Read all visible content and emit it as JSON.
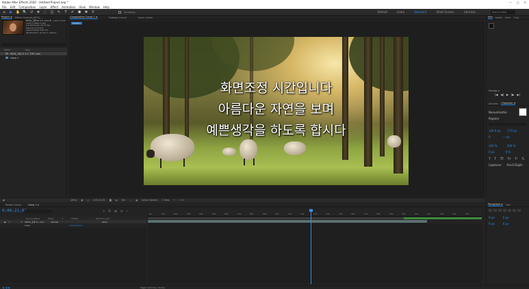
{
  "app": {
    "title": "Adobe After Effects 2020 - Untitled Project.aep *",
    "window_controls": [
      "—",
      "□",
      "✕"
    ]
  },
  "menu": [
    "File",
    "Edit",
    "Composition",
    "Layer",
    "Effect",
    "Animation",
    "View",
    "Window",
    "Help"
  ],
  "toolbar": {
    "tools": [
      "⌂",
      "▶",
      "✋",
      "🔍",
      "↺",
      "✥",
      "⬚",
      "◫",
      "✎",
      "T",
      "✐",
      "⬟",
      "✱",
      "⚲"
    ],
    "snapping_label": "Snapping",
    "workspaces": [
      "Default",
      "Learn",
      "Standard",
      "Small Screen",
      "Libraries"
    ],
    "active_workspace": "Standard",
    "search_placeholder": "Search Help"
  },
  "project_panel": {
    "tabs": [
      "Project ≡",
      "Effect Controls 6976_..."
    ],
    "file_name": "6976_그대 11 1:1 .mov",
    "used": "▼ , used 1 time",
    "info_lines": [
      "1920 x 1080 (1.00)",
      "Δ 0;00;16;29, 29.97 fps",
      "Millions of Colors",
      "Apple ProRes 422 HQ",
      "48.000 kHz / 32 bit U / Stereo"
    ],
    "columns": [
      "Name",
      "Type"
    ],
    "items": [
      {
        "name": "6976_그대 11 1:1 .TOP .mov",
        "selected": true
      },
      {
        "name": "Comp 1",
        "selected": false
      }
    ]
  },
  "composition_panel": {
    "tabs": [
      "Composition  Comp 1 ≡",
      "Footage (none)",
      "Layer (none)"
    ],
    "breadcrumb": "Comp 1",
    "caption_lines": [
      "화면조정 시간입니다",
      "아름다운 자연을 보며",
      "예쁜생각을 하도록 합시다"
    ],
    "controls": {
      "zoom": "(49%)",
      "timecode": "0;00;21;01",
      "resolution": "Full",
      "camera": "Active Camera",
      "views": "1 View",
      "exposure": "+0.0"
    }
  },
  "timeline": {
    "tabs": [
      "Render Queue",
      "Comp 1 ≡"
    ],
    "current_time": "0;00;21;01",
    "column_headers": [
      "#",
      "Source Name",
      "Mode",
      "T",
      "TrkMat",
      "Parent & Link"
    ],
    "layer": {
      "index": "1",
      "name": "6976_그대 11 .mov",
      "mode": "Normal",
      "parent": "None"
    },
    "property": {
      "name": "Scale",
      "value": "∞ 83.0,83.0 %"
    },
    "ruler_ticks": [
      "0s",
      "01s",
      "02s",
      "03s",
      "04s",
      "05s",
      "06s",
      "07s",
      "08s",
      "09s",
      "10s",
      "11s",
      "12s",
      "13s",
      "14s",
      "15s",
      "16s",
      "17s",
      "18s",
      "19s",
      "20s",
      "21s",
      "22s",
      "23s",
      "24s",
      "25s"
    ],
    "bottom_controls": [
      "Toggle Switches / Modes"
    ]
  },
  "right_panels": {
    "info_tabs": [
      "Info",
      "Audio",
      "Libra",
      "Char"
    ],
    "preview": {
      "title": "Preview ≡",
      "buttons": [
        "|◀",
        "◀|",
        "▶",
        "|▶",
        "▶|"
      ]
    },
    "character": {
      "tabs": [
        "Libraries",
        "Character ≡"
      ],
      "font": "NanumGothic",
      "style": "Regular",
      "size": "144.9 px",
      "leading": "175 px",
      "tracking": "0",
      "stroke": "— px",
      "scale_v": "100 %",
      "scale_h": "100 %",
      "baseline": "0 px",
      "tsume": "0 %",
      "ligatures": "Ligatures",
      "hindi": "Hindi Digits"
    },
    "paragraph": {
      "tabs": [
        "Paragraph ≡",
        "Trac"
      ],
      "indents": [
        "0 px",
        "0 px",
        "0 px",
        "0 px"
      ]
    }
  },
  "colors": {
    "accent": "#2d8ceb",
    "panel": "#232323",
    "chrome": "#ffffff"
  }
}
